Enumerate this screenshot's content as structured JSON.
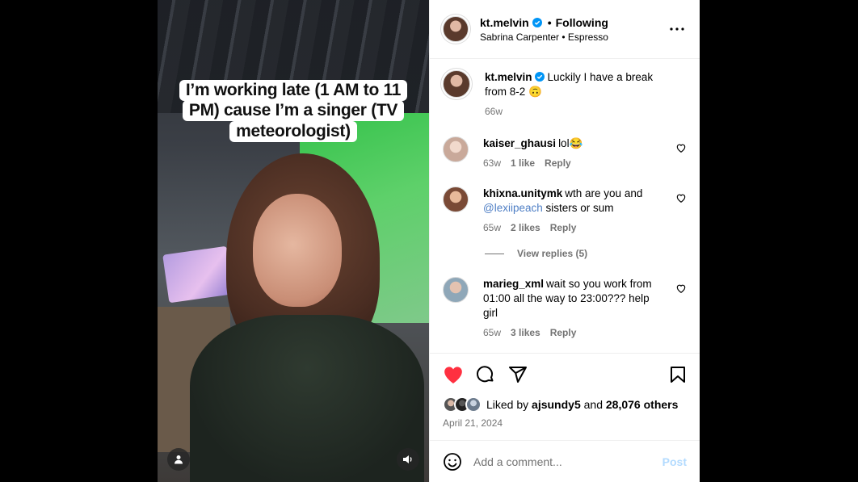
{
  "colors": {
    "accent": "#0095f6",
    "like_red": "#ff3040",
    "muted": "#737373",
    "post_disabled": "#b3dbff"
  },
  "media": {
    "caption_lines": [
      "I’m working late (1 AM to 11",
      "PM) cause I’m a singer (TV",
      "meteorologist)"
    ],
    "user_icon": "person-icon",
    "sound_icon": "speaker-icon"
  },
  "header": {
    "username": "kt.melvin",
    "separator": "•",
    "follow_label": "Following",
    "audio": "Sabrina Carpenter • Espresso",
    "more_icon": "more-horizontal-icon"
  },
  "caption": {
    "username": "kt.melvin",
    "text": "Luckily I have a break from 8-2 🙃",
    "age": "66w"
  },
  "comments": [
    {
      "username": "kaiser_ghausi",
      "text": "lol😂",
      "mention": "",
      "text_after": "",
      "age": "63w",
      "likes": "1 like",
      "reply": "Reply"
    },
    {
      "username": "khixna.unitymk",
      "text": "wth are you and ",
      "mention": "@lexiipeach",
      "text_after": " sisters or sum",
      "age": "65w",
      "likes": "2 likes",
      "reply": "Reply",
      "view_replies": "View replies (5)"
    },
    {
      "username": "marieg_xml",
      "text": "wait so you work from 01:00 all the way to 23:00??? help girl",
      "mention": "",
      "text_after": "",
      "age": "65w",
      "likes": "3 likes",
      "reply": "Reply"
    }
  ],
  "actions": {
    "like_icon": "heart-filled-icon",
    "comment_icon": "comment-icon",
    "share_icon": "share-icon",
    "save_icon": "bookmark-icon"
  },
  "likes": {
    "prefix": "Liked by ",
    "user": "ajsundy5",
    "middle": " and ",
    "others": "28,076 others"
  },
  "date": "April 21, 2024",
  "composer": {
    "placeholder": "Add a comment...",
    "post_label": "Post",
    "emoji_icon": "emoji-icon"
  }
}
